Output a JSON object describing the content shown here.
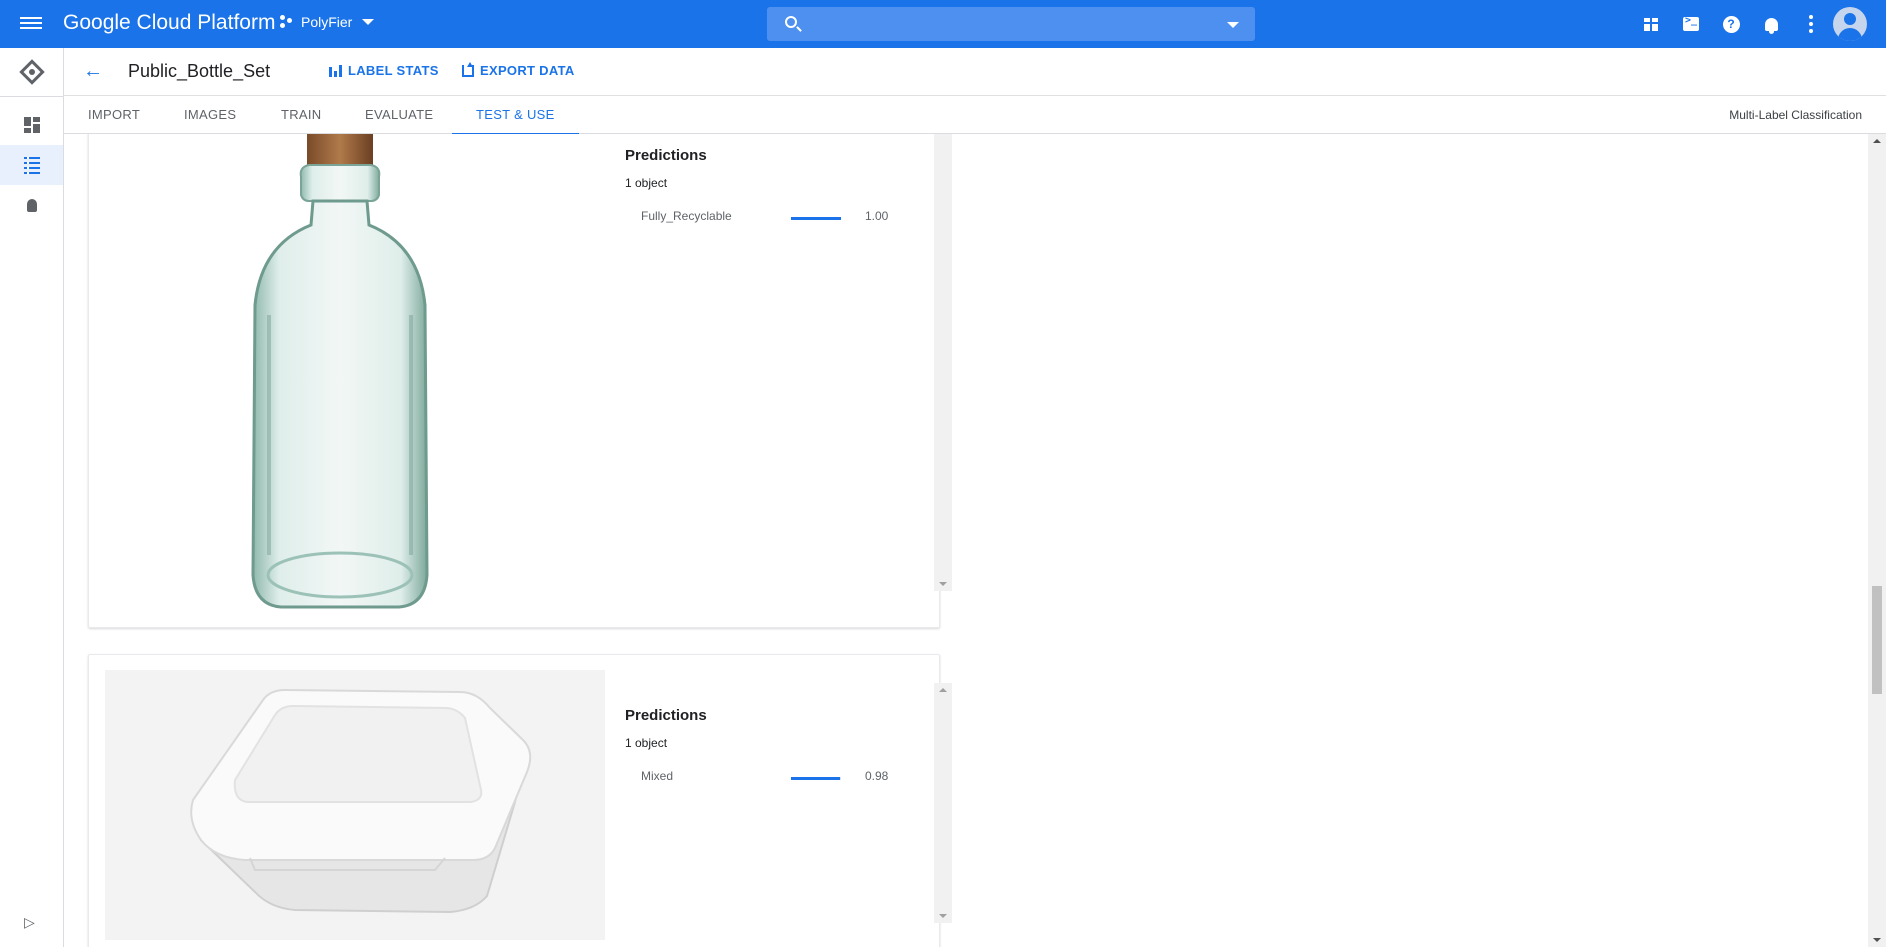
{
  "topbar": {
    "brand": "Google Cloud Platform",
    "project": "PolyFier",
    "search_placeholder": "",
    "icons": [
      "menu-icon",
      "project-icon",
      "search-icon",
      "gift-icon",
      "cloud-shell-icon",
      "help-icon",
      "notifications-icon",
      "more-vert-icon",
      "account-avatar"
    ]
  },
  "rail": {
    "icons": [
      "automl-vision-logo",
      "dashboard-icon",
      "datasets-icon",
      "lightbulb-icon",
      "expand-icon"
    ]
  },
  "header": {
    "dataset_title": "Public_Bottle_Set",
    "label_stats": "LABEL STATS",
    "export_data": "EXPORT DATA"
  },
  "tabs": {
    "items": [
      {
        "label": "IMPORT"
      },
      {
        "label": "IMAGES"
      },
      {
        "label": "TRAIN"
      },
      {
        "label": "EVALUATE"
      },
      {
        "label": "TEST & USE"
      }
    ],
    "active": "TEST & USE",
    "mode": "Multi-Label Classification"
  },
  "results": [
    {
      "image": "glass-bottle-with-cork",
      "heading": "Predictions",
      "count": "1 object",
      "predictions": [
        {
          "label": "Fully_Recyclable",
          "score": "1.00",
          "fraction": 1.0
        }
      ]
    },
    {
      "image": "white-foam-takeout-box",
      "heading": "Predictions",
      "count": "1 object",
      "predictions": [
        {
          "label": "Mixed",
          "score": "0.98",
          "fraction": 0.98
        }
      ]
    }
  ],
  "colors": {
    "brand_blue": "#1a73e8",
    "text": "#202124",
    "muted": "#5f6368"
  }
}
